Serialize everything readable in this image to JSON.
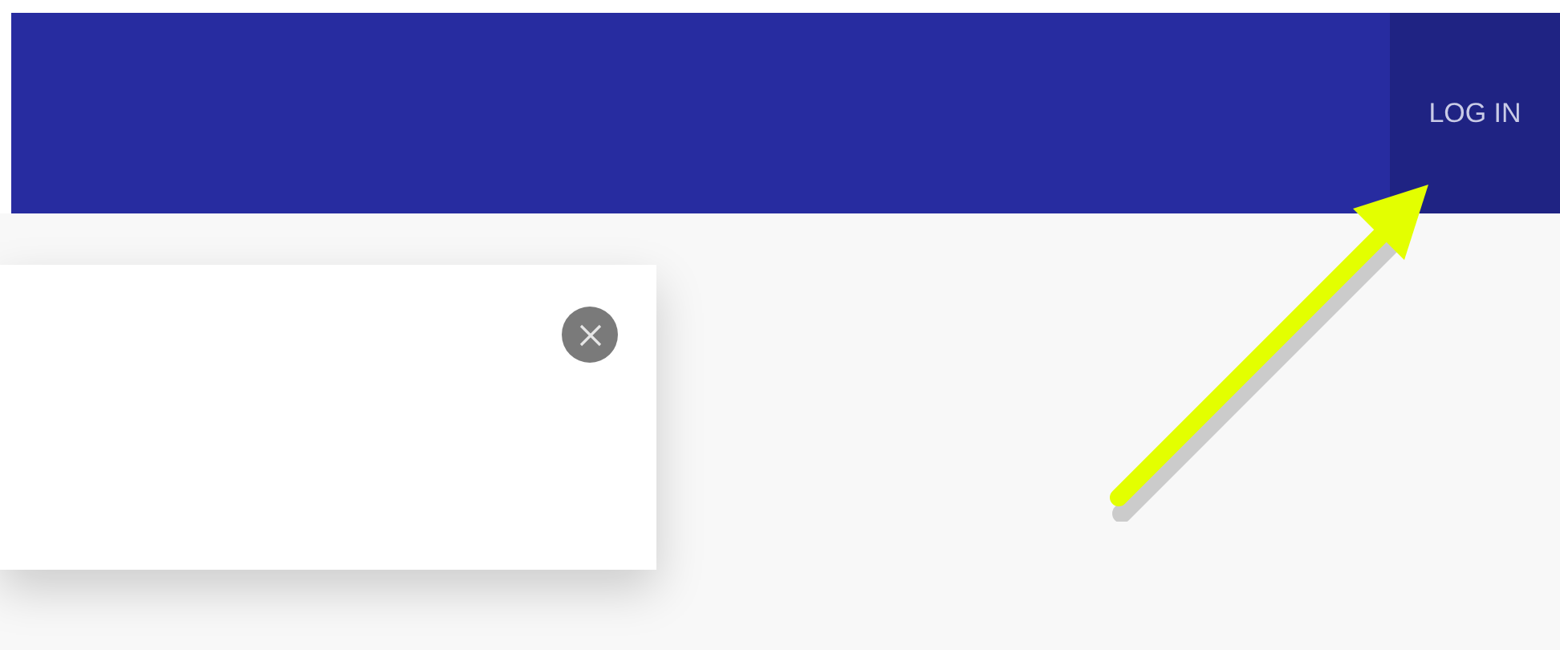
{
  "header": {
    "login_button": {
      "label": "LOG IN"
    }
  }
}
